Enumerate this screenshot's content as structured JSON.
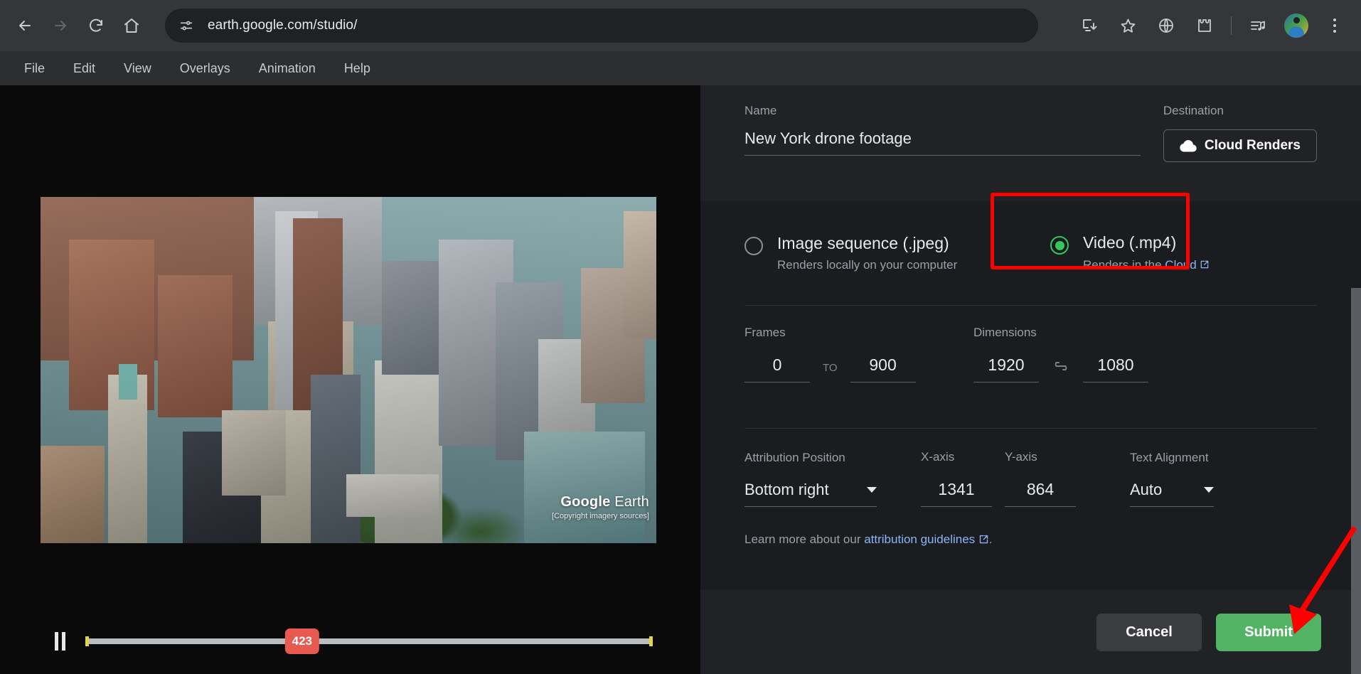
{
  "browser": {
    "url": "earth.google.com/studio/",
    "nav": [
      {
        "name": "back",
        "label": "Back"
      },
      {
        "name": "forward",
        "label": "Forward"
      },
      {
        "name": "reload",
        "label": "Reload"
      },
      {
        "name": "home",
        "label": "Home"
      }
    ],
    "site_info_icon": "tune-icon",
    "toolbar_icons": [
      {
        "name": "install-app-icon",
        "label": "Install"
      },
      {
        "name": "bookmark-star-icon",
        "label": "Bookmark"
      },
      {
        "name": "globe-icon",
        "label": "Translate"
      },
      {
        "name": "extensions-icon",
        "label": "Extensions"
      },
      {
        "name": "media-playlist-icon",
        "label": "Media"
      },
      {
        "name": "avatar",
        "label": "Profile"
      },
      {
        "name": "chrome-menu-icon",
        "label": "Customize and control"
      }
    ]
  },
  "menubar": {
    "items": [
      {
        "label": "File"
      },
      {
        "label": "Edit"
      },
      {
        "label": "View"
      },
      {
        "label": "Overlays"
      },
      {
        "label": "Animation"
      },
      {
        "label": "Help"
      }
    ]
  },
  "viewport": {
    "attribution_brand": "Google",
    "attribution_product": " Earth",
    "attribution_copyright": "[Copyright imagery sources]",
    "player": {
      "state": "playing",
      "pause_label": "Pause",
      "current_frame": "423",
      "range_start": "0",
      "range_end": "900",
      "progress_percent": 38.2
    }
  },
  "panel": {
    "name": {
      "label": "Name",
      "value": "New York drone footage",
      "placeholder": "Name"
    },
    "destination": {
      "label": "Destination",
      "button_label": "Cloud Renders",
      "icon": "cloud-icon"
    },
    "format": {
      "options": [
        {
          "title": "Image sequence (.jpeg)",
          "subtitle": "Renders locally on your computer",
          "selected": false
        },
        {
          "title": "Video (.mp4)",
          "subtitle_prefix": "Renders in the ",
          "subtitle_link": "Cloud",
          "selected": true,
          "highlighted": true
        }
      ],
      "highlight_color": "#ff0000",
      "selected_color": "#34c759"
    },
    "frames": {
      "label": "Frames",
      "start": "0",
      "to_label": "TO",
      "end": "900"
    },
    "dimensions": {
      "label": "Dimensions",
      "width": "1920",
      "height": "1080",
      "link_icon": "link-icon",
      "linked": true
    },
    "attribution": {
      "position_label": "Attribution Position",
      "position_value": "Bottom right",
      "x_label": "X-axis",
      "x_value": "1341",
      "y_label": "Y-axis",
      "y_value": "864",
      "align_label": "Text Alignment",
      "align_value": "Auto",
      "learn_prefix": "Learn more about our ",
      "learn_link": "attribution guidelines",
      "learn_suffix": "."
    },
    "footer": {
      "cancel_label": "Cancel",
      "submit_label": "Submit",
      "submit_color": "#53b364"
    }
  },
  "annotations": {
    "arrow_color": "#ff0000",
    "arrow_target": "submit-button",
    "box_target": "video-mp4-option"
  }
}
